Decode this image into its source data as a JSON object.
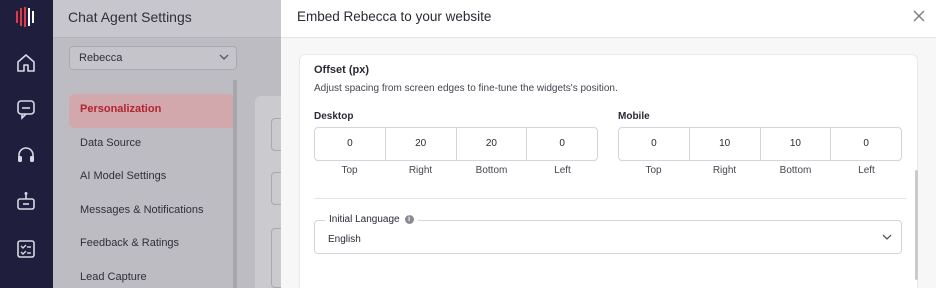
{
  "rail": {
    "icons": [
      "logo-icon",
      "home-icon",
      "chat-icon",
      "headset-icon",
      "bot-icon",
      "checklist-icon"
    ]
  },
  "page": {
    "title": "Chat Agent Settings",
    "agent_select": "Rebecca",
    "menu": [
      {
        "label": "Personalization",
        "active": true
      },
      {
        "label": "Data Source",
        "active": false
      },
      {
        "label": "AI Model Settings",
        "active": false
      },
      {
        "label": "Messages & Notifications",
        "active": false
      },
      {
        "label": "Feedback & Ratings",
        "active": false
      },
      {
        "label": "Lead Capture",
        "active": false
      }
    ]
  },
  "modal": {
    "title": "Embed Rebecca to your website",
    "offset": {
      "title": "Offset (px)",
      "description": "Adjust spacing from screen edges to fine-tune the widgets's position.",
      "desktop": {
        "label": "Desktop",
        "values": [
          "0",
          "20",
          "20",
          "0"
        ],
        "captions": [
          "Top",
          "Right",
          "Bottom",
          "Left"
        ]
      },
      "mobile": {
        "label": "Mobile",
        "values": [
          "0",
          "10",
          "10",
          "0"
        ],
        "captions": [
          "Top",
          "Right",
          "Bottom",
          "Left"
        ]
      }
    },
    "language": {
      "label": "Initial Language",
      "value": "English"
    }
  },
  "colors": {
    "rail": "#1f1f3d",
    "accent": "#e03a47",
    "active_text": "#b0252f"
  }
}
